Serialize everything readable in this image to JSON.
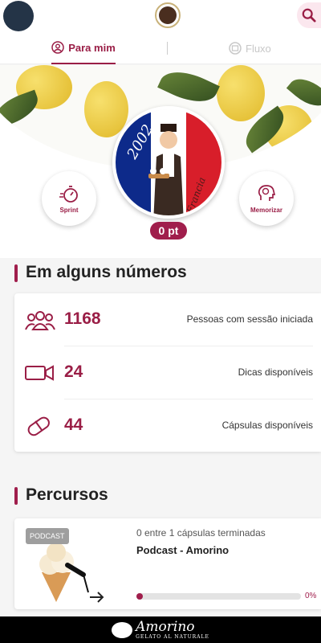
{
  "header": {
    "profile_icon": "avatar",
    "logo_icon": "brand-logo",
    "search_icon": "search-icon"
  },
  "tabs": [
    {
      "label": "Para mim",
      "icon": "user-circle-icon",
      "active": true
    },
    {
      "label": "Fluxo",
      "icon": "feed-icon",
      "active": false
    }
  ],
  "hero": {
    "medal_year": "2002",
    "medal_country": "Francia",
    "sprint_label": "Sprint",
    "memorize_label": "Memorizar",
    "points": "0 pt"
  },
  "stats": {
    "title": "Em alguns números",
    "items": [
      {
        "value": "1168",
        "label": "Pessoas com sessão iniciada",
        "icon": "people-icon"
      },
      {
        "value": "24",
        "label": "Dicas disponíveis",
        "icon": "video-icon"
      },
      {
        "value": "44",
        "label": "Cápsulas disponíveis",
        "icon": "pill-icon"
      }
    ]
  },
  "courses": {
    "title": "Percursos",
    "items": [
      {
        "badge": "PODCAST",
        "progress_text": "0 entre 1 cápsulas terminadas",
        "name": "Podcast - Amorino",
        "percent": 0,
        "percent_label": "0%"
      }
    ]
  },
  "footer": {
    "brand": "Amorino",
    "tagline": "GELATO AL NATURALE"
  },
  "colors": {
    "accent": "#a01e4c",
    "flag_blue": "#0d2a8a",
    "flag_red": "#d81e2a"
  }
}
